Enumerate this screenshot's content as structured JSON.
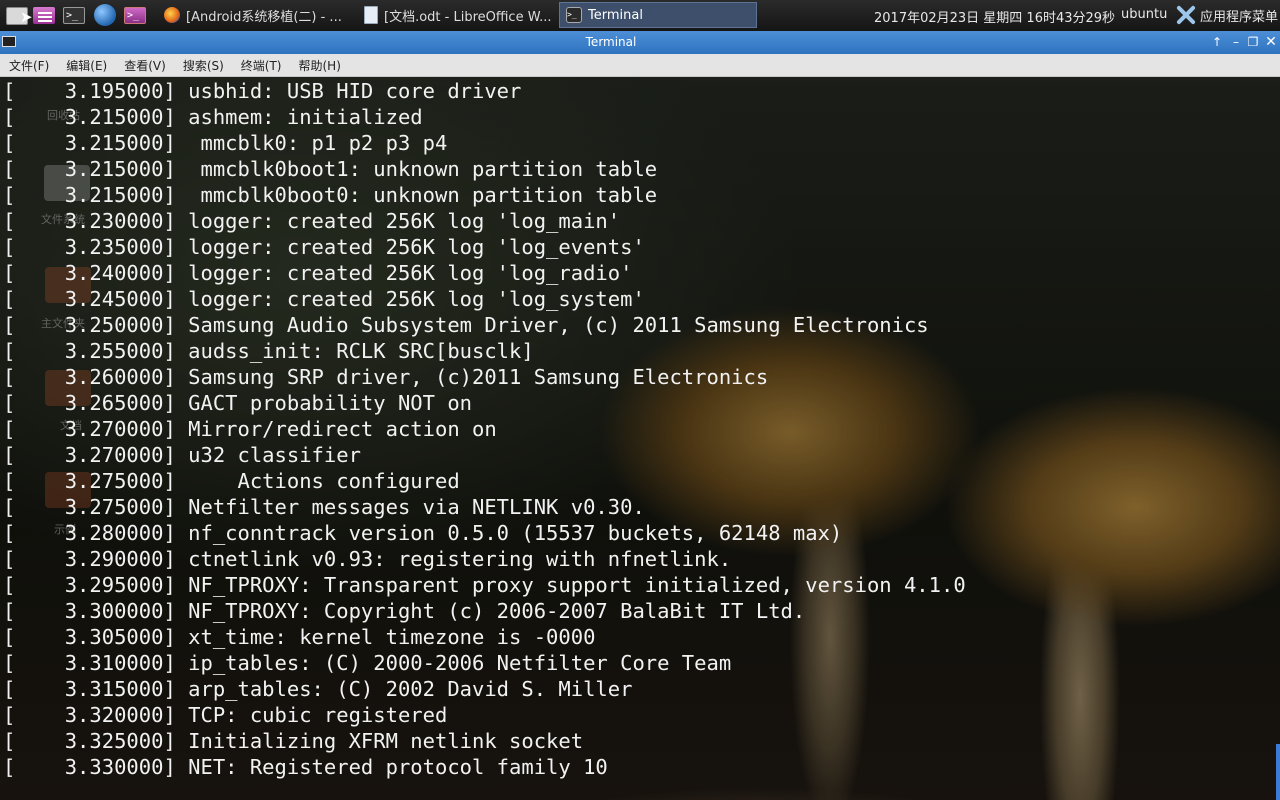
{
  "panel": {
    "launchers": [
      {
        "name": "file-manager-launcher",
        "icon": "file-manager-icon"
      },
      {
        "name": "text-editor-launcher",
        "icon": "text-editor-icon"
      },
      {
        "name": "terminal-launcher",
        "icon": "terminal-icon"
      },
      {
        "name": "web-browser-launcher",
        "icon": "web-browser-icon"
      },
      {
        "name": "terminal-launcher-2",
        "icon": "terminal-icon"
      }
    ],
    "tasks": [
      {
        "label": "[Android系统移植(二) - ...",
        "icon": "firefox-icon",
        "active": false
      },
      {
        "label": "[文档.odt - LibreOffice W...",
        "icon": "document-icon",
        "active": false
      },
      {
        "label": "Terminal",
        "icon": "terminal-icon",
        "active": true
      }
    ],
    "clock": "2017年02月23日 星期四 16时43分29秒",
    "user": "ubuntu",
    "apps_menu": "应用程序菜单"
  },
  "window": {
    "title": "Terminal",
    "controls": {
      "shade": "↑",
      "minimize": "–",
      "maximize": "❐",
      "close": "✕"
    },
    "accent": "#2f73c0"
  },
  "menu": [
    "文件(F)",
    "编辑(E)",
    "查看(V)",
    "搜索(S)",
    "终端(T)",
    "帮助(H)"
  ],
  "desktop_icons": [
    "回收站",
    "文件系统",
    "主文件夹",
    "文档",
    "示例"
  ],
  "terminal": {
    "lines": [
      "[    3.195000] usbhid: USB HID core driver",
      "[    3.215000] ashmem: initialized",
      "[    3.215000]  mmcblk0: p1 p2 p3 p4",
      "[    3.215000]  mmcblk0boot1: unknown partition table",
      "[    3.215000]  mmcblk0boot0: unknown partition table",
      "[    3.230000] logger: created 256K log 'log_main'",
      "[    3.235000] logger: created 256K log 'log_events'",
      "[    3.240000] logger: created 256K log 'log_radio'",
      "[    3.245000] logger: created 256K log 'log_system'",
      "[    3.250000] Samsung Audio Subsystem Driver, (c) 2011 Samsung Electronics",
      "[    3.255000] audss_init: RCLK SRC[busclk]",
      "[    3.260000] Samsung SRP driver, (c)2011 Samsung Electronics",
      "[    3.265000] GACT probability NOT on",
      "[    3.270000] Mirror/redirect action on",
      "[    3.270000] u32 classifier",
      "[    3.275000]     Actions configured",
      "[    3.275000] Netfilter messages via NETLINK v0.30.",
      "[    3.280000] nf_conntrack version 0.5.0 (15537 buckets, 62148 max)",
      "[    3.290000] ctnetlink v0.93: registering with nfnetlink.",
      "[    3.295000] NF_TPROXY: Transparent proxy support initialized, version 4.1.0",
      "[    3.300000] NF_TPROXY: Copyright (c) 2006-2007 BalaBit IT Ltd.",
      "[    3.305000] xt_time: kernel timezone is -0000",
      "[    3.310000] ip_tables: (C) 2000-2006 Netfilter Core Team",
      "[    3.315000] arp_tables: (C) 2002 David S. Miller",
      "[    3.320000] TCP: cubic registered",
      "[    3.325000] Initializing XFRM netlink socket",
      "[    3.330000] NET: Registered protocol family 10"
    ]
  }
}
